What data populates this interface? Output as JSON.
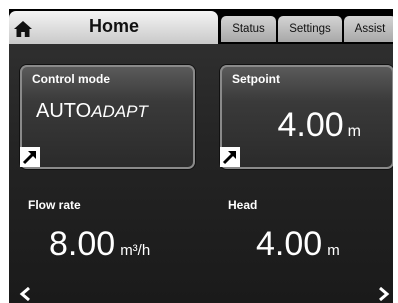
{
  "tabs": {
    "home_icon": "home-icon",
    "home": "Home",
    "status": "Status",
    "settings": "Settings",
    "assist": "Assist"
  },
  "control_mode": {
    "label": "Control mode",
    "value_main": "AUTO",
    "value_suffix": "ADAPT"
  },
  "setpoint": {
    "label": "Setpoint",
    "value": "4.00",
    "unit": "m"
  },
  "flow_rate": {
    "label": "Flow rate",
    "value": "8.00",
    "unit": "m³/h"
  },
  "head": {
    "label": "Head",
    "value": "4.00",
    "unit": "m"
  },
  "colors": {
    "tab_active": "#e6e6e6",
    "tab_inactive": "#bdbdbd",
    "panel": "#262626",
    "text": "#ffffff"
  }
}
